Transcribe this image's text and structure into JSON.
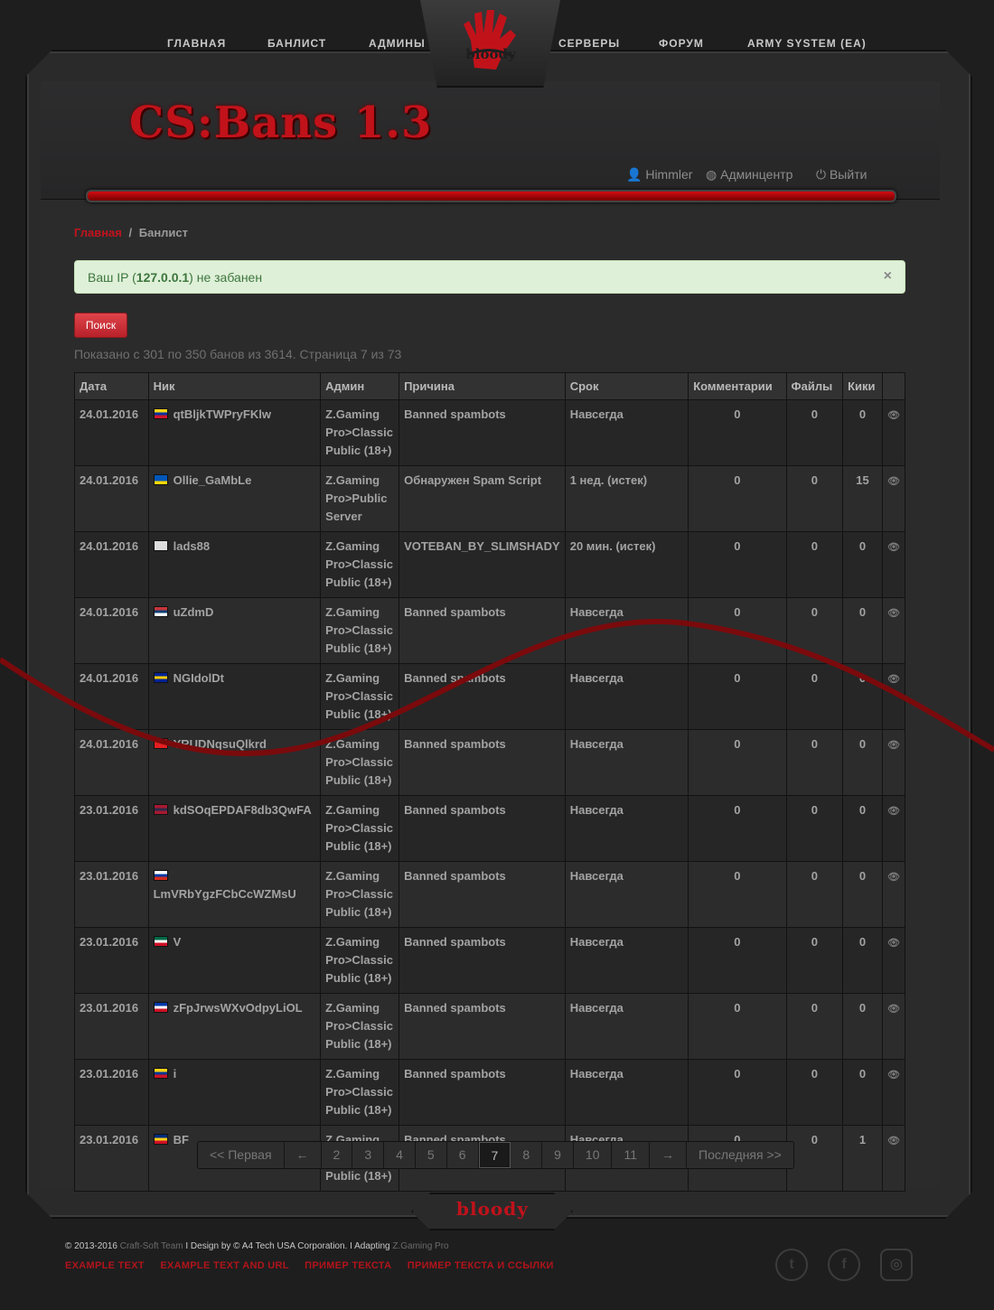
{
  "nav": {
    "home": "ГЛАВНАЯ",
    "banlist": "БАНЛИСТ",
    "admins": "АДМИНЫ",
    "servers": "СЕРВЕРЫ",
    "forum": "ФОРУМ",
    "army": "ARMY SYSTEM (EA)"
  },
  "logo_text": "bloody",
  "site_title": "CS:Bans 1.3",
  "user": {
    "username": "Himmler",
    "admincenter": "Админцентр",
    "logout": "Выйти"
  },
  "breadcrumb": {
    "home": "Главная",
    "separator": "/",
    "current": "Банлист"
  },
  "alert": {
    "prefix": "Ваш IP (",
    "ip": "127.0.0.1",
    "suffix": ") не забанен",
    "close": "×"
  },
  "search_button": "Поиск",
  "summary": "Показано с 301 по 350 банов из 3614. Страница 7 из 73",
  "table": {
    "headers": [
      "Дата",
      "Ник",
      "Админ",
      "Причина",
      "Срок",
      "Комментарии",
      "Файлы",
      "Кики"
    ],
    "rows": [
      {
        "date": "24.01.2016",
        "flag": "venezuela",
        "nick": "qtBljkTWPryFKlw",
        "admin": "Z.Gaming Pro>Classic Public (18+)",
        "reason": "Banned spambots",
        "term": "Навсегда",
        "comments": "0",
        "files": "0",
        "kicks": "0"
      },
      {
        "date": "24.01.2016",
        "flag": "ukraine",
        "nick": "Ollie_GaMbLe",
        "admin": "Z.Gaming Pro>Public Server",
        "reason": "Обнаружен Spam Script",
        "term": "1 нед. (истек)",
        "comments": "0",
        "files": "0",
        "kicks": "15"
      },
      {
        "date": "24.01.2016",
        "flag": "unknown",
        "nick": "lads88",
        "admin": "Z.Gaming Pro>Classic Public (18+)",
        "reason": "VOTEBAN_BY_SLIMSHADY",
        "term": "20 мин. (истек)",
        "comments": "0",
        "files": "0",
        "kicks": "0"
      },
      {
        "date": "24.01.2016",
        "flag": "serbia",
        "nick": "uZdmD",
        "admin": "Z.Gaming Pro>Classic Public (18+)",
        "reason": "Banned spambots",
        "term": "Навсегда",
        "comments": "0",
        "files": "0",
        "kicks": "0"
      },
      {
        "date": "24.01.2016",
        "flag": "bosnia",
        "nick": "NGIdolDt",
        "admin": "Z.Gaming Pro>Classic Public (18+)",
        "reason": "Banned spambots",
        "term": "Навсегда",
        "comments": "0",
        "files": "0",
        "kicks": "0"
      },
      {
        "date": "24.01.2016",
        "flag": "albania",
        "nick": "YRUDNqsuQlkrd",
        "admin": "Z.Gaming Pro>Classic Public (18+)",
        "reason": "Banned spambots",
        "term": "Навсегда",
        "comments": "0",
        "files": "0",
        "kicks": "0"
      },
      {
        "date": "23.01.2016",
        "flag": "thailand",
        "nick": "kdSOqEPDAF8db3QwFA",
        "admin": "Z.Gaming Pro>Classic Public (18+)",
        "reason": "Banned spambots",
        "term": "Навсегда",
        "comments": "0",
        "files": "0",
        "kicks": "0"
      },
      {
        "date": "23.01.2016",
        "flag": "russia",
        "nick": "LmVRbYgzFCbCcWZMsU",
        "admin": "Z.Gaming Pro>Classic Public (18+)",
        "reason": "Banned spambots",
        "term": "Навсегда",
        "comments": "0",
        "files": "0",
        "kicks": "0"
      },
      {
        "date": "23.01.2016",
        "flag": "mexico",
        "nick": "V",
        "admin": "Z.Gaming Pro>Classic Public (18+)",
        "reason": "Banned spambots",
        "term": "Навсегда",
        "comments": "0",
        "files": "0",
        "kicks": "0"
      },
      {
        "date": "23.01.2016",
        "flag": "philippines",
        "nick": "zFpJrwsWXvOdpyLiOL",
        "admin": "Z.Gaming Pro>Classic Public (18+)",
        "reason": "Banned spambots",
        "term": "Навсегда",
        "comments": "0",
        "files": "0",
        "kicks": "0"
      },
      {
        "date": "23.01.2016",
        "flag": "colombia",
        "nick": "i",
        "admin": "Z.Gaming Pro>Classic Public (18+)",
        "reason": "Banned spambots",
        "term": "Навсегда",
        "comments": "0",
        "files": "0",
        "kicks": "0"
      },
      {
        "date": "23.01.2016",
        "flag": "romania",
        "nick": "BF",
        "admin": "Z.Gaming Pro>Classic Public (18+)",
        "reason": "Banned spambots",
        "term": "Навсегда",
        "comments": "0",
        "files": "0",
        "kicks": "1"
      }
    ]
  },
  "pager": {
    "first": "<< Первая",
    "prev": "←",
    "pages": [
      "2",
      "3",
      "4",
      "5",
      "6",
      "7",
      "8",
      "9",
      "10",
      "11"
    ],
    "current": "7",
    "next": "→",
    "last": "Последняя >>"
  },
  "footer": {
    "copyright_a": "© 2013-2016 ",
    "copyright_team": "Craft-Soft Team",
    "copyright_b": " I Design by © A4 Tech USA Corporation. I Adapting ",
    "copyright_c": "Z.Gaming Pro",
    "links": [
      "EXAMPLE TEXT",
      "EXAMPLE TEXT AND URL",
      "ПРИМЕР ТЕКСТА",
      "ПРИМЕР ТЕКСТА И ССЫЛКИ"
    ],
    "social": [
      "twitter-icon",
      "facebook-icon",
      "instagram-icon"
    ]
  },
  "colors": {
    "accent_red": "#c1121a",
    "success_bg": "#dff0d8",
    "success_text": "#3c763d"
  }
}
